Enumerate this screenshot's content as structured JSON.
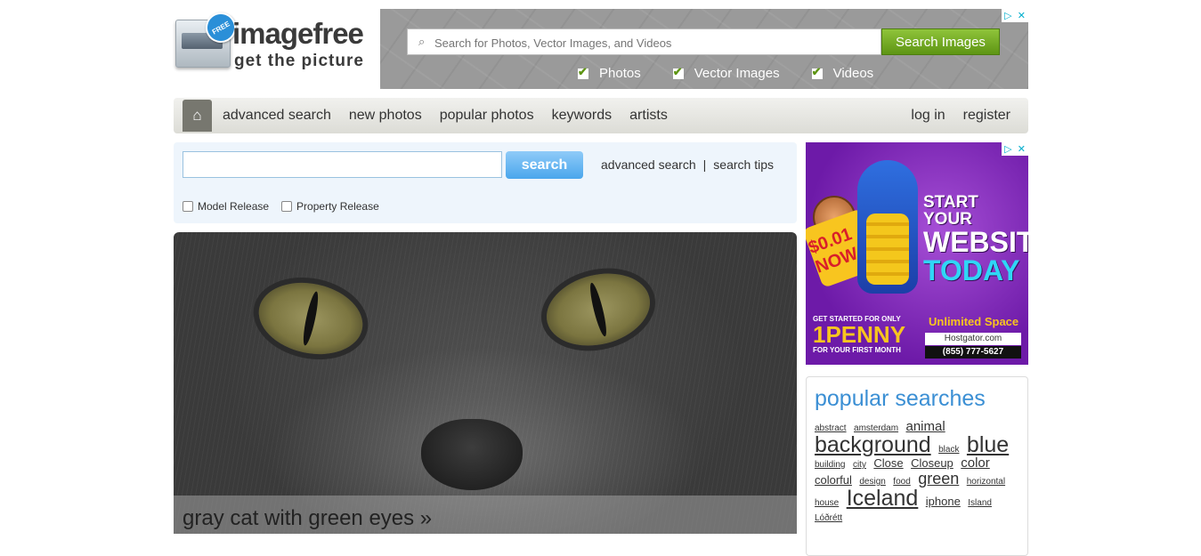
{
  "logo": {
    "badge": "FREE",
    "title": "imagefree",
    "tagline": "get the picture"
  },
  "top_ad": {
    "search_placeholder": "Search for Photos, Vector Images, and Videos",
    "button": "Search Images",
    "checks": [
      "Photos",
      "Vector Images",
      "Videos"
    ],
    "corner": [
      "▷",
      "✕"
    ]
  },
  "nav": {
    "home_icon": "home-icon",
    "links": [
      "advanced search",
      "new photos",
      "popular photos",
      "keywords",
      "artists"
    ],
    "right": [
      "log in",
      "register"
    ]
  },
  "search": {
    "value": "",
    "button": "search",
    "links": [
      "advanced search",
      "search tips"
    ],
    "separator": "|",
    "checks": [
      "Model Release",
      "Property Release"
    ]
  },
  "hero": {
    "caption": "gray cat with green eyes »"
  },
  "right_ad": {
    "price": "$0.01 NOW",
    "headline": [
      "START YOUR",
      "WEBSITE",
      "TODAY"
    ],
    "penny_line1": "GET STARTED FOR ONLY",
    "penny_big": "1PENNY",
    "penny_line2": "FOR YOUR FIRST MONTH",
    "unlimited": "Unlimited Space",
    "host": "Hostgator.com",
    "phone": "(855) 777-5627",
    "corner": [
      "▷",
      "✕"
    ]
  },
  "popular": {
    "title": "popular searches",
    "tags": [
      {
        "text": "abstract",
        "size": "s1"
      },
      {
        "text": "amsterdam",
        "size": "s1"
      },
      {
        "text": "animal",
        "size": "s3"
      },
      {
        "text": "background",
        "size": "s5"
      },
      {
        "text": "black",
        "size": "s1"
      },
      {
        "text": "blue",
        "size": "s5"
      },
      {
        "text": "building",
        "size": "s1"
      },
      {
        "text": "city",
        "size": "s1"
      },
      {
        "text": "Close",
        "size": "s2"
      },
      {
        "text": "Closeup",
        "size": "s2"
      },
      {
        "text": "color",
        "size": "s3"
      },
      {
        "text": "colorful",
        "size": "s2"
      },
      {
        "text": "design",
        "size": "s1"
      },
      {
        "text": "food",
        "size": "s1"
      },
      {
        "text": "green",
        "size": "s4"
      },
      {
        "text": "horizontal",
        "size": "s1"
      },
      {
        "text": "house",
        "size": "s1"
      },
      {
        "text": "Iceland",
        "size": "s5"
      },
      {
        "text": "iphone",
        "size": "s2"
      },
      {
        "text": "Island",
        "size": "s1"
      },
      {
        "text": "Lóðrétt",
        "size": "s1"
      }
    ]
  }
}
